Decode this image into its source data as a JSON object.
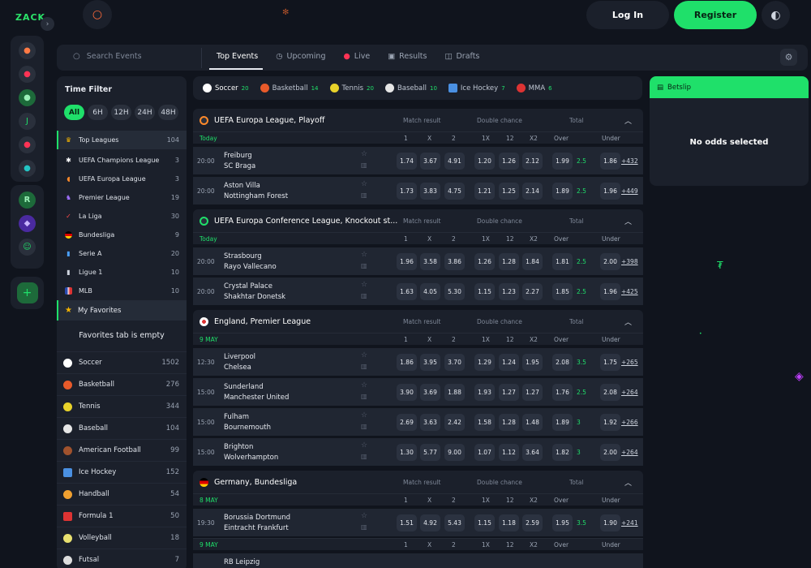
{
  "header": {
    "logo_text": "ZACK",
    "login_label": "Log In",
    "register_label": "Register"
  },
  "nav": {
    "search_placeholder": "Search Events",
    "tabs": [
      {
        "label": "Top Events",
        "icon": "none"
      },
      {
        "label": "Upcoming",
        "icon": "clock-icon"
      },
      {
        "label": "Live",
        "icon": "live-dot-icon"
      },
      {
        "label": "Results",
        "icon": "results-icon"
      },
      {
        "label": "Drafts",
        "icon": "drafts-icon"
      }
    ]
  },
  "sidebar": {
    "time_filter_title": "Time Filter",
    "time_filters": [
      "All",
      "6H",
      "12H",
      "24H",
      "48H"
    ],
    "top_leagues": {
      "label": "Top Leagues",
      "count": "104"
    },
    "leagues": [
      {
        "label": "UEFA Champions League",
        "count": "3",
        "icon": "ucl-icon"
      },
      {
        "label": "UEFA Europa League",
        "count": "3",
        "icon": "uel-icon"
      },
      {
        "label": "Premier League",
        "count": "19",
        "icon": "epl-icon"
      },
      {
        "label": "La Liga",
        "count": "30",
        "icon": "laliga-icon"
      },
      {
        "label": "Bundesliga",
        "count": "9",
        "icon": "germany-flag-icon"
      },
      {
        "label": "Serie A",
        "count": "20",
        "icon": "seriea-icon"
      },
      {
        "label": "Ligue 1",
        "count": "10",
        "icon": "ligue1-icon"
      },
      {
        "label": "MLB",
        "count": "10",
        "icon": "usa-flag-icon"
      }
    ],
    "favorites_label": "My Favorites",
    "favorites_empty": "Favorites tab is empty",
    "sports": [
      {
        "label": "Soccer",
        "count": "1502"
      },
      {
        "label": "Basketball",
        "count": "276"
      },
      {
        "label": "Tennis",
        "count": "344"
      },
      {
        "label": "Baseball",
        "count": "104"
      },
      {
        "label": "American Football",
        "count": "99"
      },
      {
        "label": "Ice Hockey",
        "count": "152"
      },
      {
        "label": "Handball",
        "count": "54"
      },
      {
        "label": "Formula 1",
        "count": "50"
      },
      {
        "label": "Volleyball",
        "count": "18"
      },
      {
        "label": "Futsal",
        "count": "7"
      }
    ]
  },
  "sport_tabs": [
    {
      "label": "Soccer",
      "count": "20"
    },
    {
      "label": "Basketball",
      "count": "14"
    },
    {
      "label": "Tennis",
      "count": "20"
    },
    {
      "label": "Baseball",
      "count": "10"
    },
    {
      "label": "Ice Hockey",
      "count": "7"
    },
    {
      "label": "MMA",
      "count": "6"
    }
  ],
  "market_headers": {
    "match_result": "Match result",
    "double_chance": "Double chance",
    "total": "Total",
    "h1": "1",
    "hx": "X",
    "h2": "2",
    "h1x": "1X",
    "h12": "12",
    "hx2": "X2",
    "over": "Over",
    "under": "Under"
  },
  "leagues": [
    {
      "name": "UEFA Europa League, Playoff",
      "date": "Today",
      "matches": [
        {
          "time": "20:00",
          "home": "Freiburg",
          "away": "SC Braga",
          "odds": [
            "1.74",
            "3.67",
            "4.91",
            "1.20",
            "1.26",
            "2.12",
            "1.99",
            "2.5",
            "1.86"
          ],
          "more": "+432"
        },
        {
          "time": "20:00",
          "home": "Aston Villa",
          "away": "Nottingham Forest",
          "odds": [
            "1.73",
            "3.83",
            "4.75",
            "1.21",
            "1.25",
            "2.14",
            "1.89",
            "2.5",
            "1.96"
          ],
          "more": "+449"
        }
      ]
    },
    {
      "name": "UEFA Europa Conference League, Knockout st...",
      "date": "Today",
      "matches": [
        {
          "time": "20:00",
          "home": "Strasbourg",
          "away": "Rayo Vallecano",
          "odds": [
            "1.96",
            "3.58",
            "3.86",
            "1.26",
            "1.28",
            "1.84",
            "1.81",
            "2.5",
            "2.00"
          ],
          "more": "+398"
        },
        {
          "time": "20:00",
          "home": "Crystal Palace",
          "away": "Shakhtar Donetsk",
          "odds": [
            "1.63",
            "4.05",
            "5.30",
            "1.15",
            "1.23",
            "2.27",
            "1.85",
            "2.5",
            "1.96"
          ],
          "more": "+425"
        }
      ]
    },
    {
      "name": "England, Premier League",
      "date": "9 MAY",
      "matches": [
        {
          "time": "12:30",
          "home": "Liverpool",
          "away": "Chelsea",
          "odds": [
            "1.86",
            "3.95",
            "3.70",
            "1.29",
            "1.24",
            "1.95",
            "2.08",
            "3.5",
            "1.75"
          ],
          "more": "+265"
        },
        {
          "time": "15:00",
          "home": "Sunderland",
          "away": "Manchester United",
          "odds": [
            "3.90",
            "3.69",
            "1.88",
            "1.93",
            "1.27",
            "1.27",
            "1.76",
            "2.5",
            "2.08"
          ],
          "more": "+264"
        },
        {
          "time": "15:00",
          "home": "Fulham",
          "away": "Bournemouth",
          "odds": [
            "2.69",
            "3.63",
            "2.42",
            "1.58",
            "1.28",
            "1.48",
            "1.89",
            "3",
            "1.92"
          ],
          "more": "+266"
        },
        {
          "time": "15:00",
          "home": "Brighton",
          "away": "Wolverhampton",
          "odds": [
            "1.30",
            "5.77",
            "9.00",
            "1.07",
            "1.12",
            "3.64",
            "1.82",
            "3",
            "2.00"
          ],
          "more": "+264"
        }
      ]
    },
    {
      "name": "Germany, Bundesliga",
      "date": "8 MAY",
      "matches": [
        {
          "time": "19:30",
          "home": "Borussia Dortmund",
          "away": "Eintracht Frankfurt",
          "odds": [
            "1.51",
            "4.92",
            "5.43",
            "1.15",
            "1.18",
            "2.59",
            "1.95",
            "3.5",
            "1.90"
          ],
          "more": "+241"
        }
      ],
      "date2": "9 MAY",
      "partial_match": {
        "home": "RB Leipzig"
      }
    }
  ],
  "betslip": {
    "title": "Betslip",
    "empty_text": "No odds selected"
  },
  "colors": {
    "accent": "#1fe06a",
    "background": "#10141d",
    "panel": "#1b202b",
    "row": "#202632"
  }
}
